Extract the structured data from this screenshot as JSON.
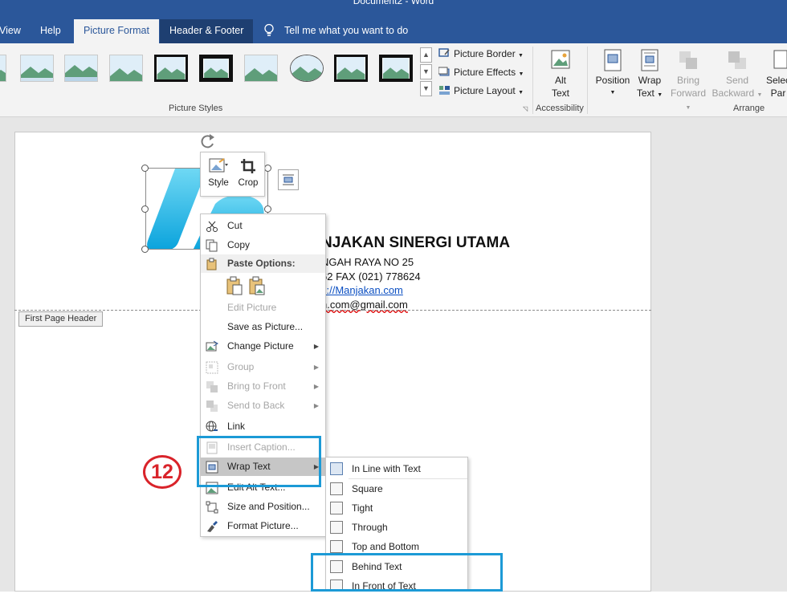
{
  "window": {
    "title": "Document2  -  Word"
  },
  "tabs": [
    {
      "label": "View",
      "state": "normal"
    },
    {
      "label": "Help",
      "state": "normal"
    },
    {
      "label": "Picture Format",
      "state": "active"
    },
    {
      "label": "Header & Footer",
      "state": "contextual"
    }
  ],
  "tell_me": "Tell me what you want to do",
  "ribbon": {
    "picture_border": "Picture Border",
    "picture_effects": "Picture Effects",
    "picture_layout": "Picture Layout",
    "group_picture_styles": "Picture Styles",
    "alt_text_line1": "Alt",
    "alt_text_line2": "Text",
    "group_accessibility": "Accessibility",
    "position_label": "Position",
    "wrap_line1": "Wrap",
    "wrap_line2": "Text",
    "bring_line1": "Bring",
    "bring_line2": "Forward",
    "send_line1": "Send",
    "send_line2": "Backward",
    "select_line1": "Selec",
    "select_line2": "Par",
    "group_arrange": "Arrange"
  },
  "document": {
    "company": "NJAKAN SINERGI UTAMA",
    "address": "NGAH RAYA NO 25",
    "phone": "62 FAX (021) 778624",
    "website": "s://Manjakan.com",
    "email": "n.com@gmail.com",
    "header_tag": "First Page Header"
  },
  "mini_toolbar": {
    "style": "Style",
    "crop": "Crop"
  },
  "context_menu": {
    "cut": "Cut",
    "copy": "Copy",
    "paste_options": "Paste Options:",
    "edit_picture": "Edit Picture",
    "save_as_picture": "Save as Picture...",
    "change_picture": "Change Picture",
    "group": "Group",
    "bring_to_front": "Bring to Front",
    "send_to_back": "Send to Back",
    "link": "Link",
    "insert_caption": "Insert Caption...",
    "wrap_text": "Wrap Text",
    "edit_alt_text": "Edit Alt Text...",
    "size_and_position": "Size and Position...",
    "format_picture": "Format Picture..."
  },
  "wrap_submenu": {
    "in_line": "In Line with Text",
    "square": "Square",
    "tight": "Tight",
    "through": "Through",
    "top_bottom": "Top and Bottom",
    "behind": "Behind Text",
    "in_front": "In Front of Text"
  },
  "annotation": {
    "step": "12"
  },
  "colors": {
    "ribbon_blue": "#2b579a",
    "highlight_box": "#1c9ad6",
    "step_badge": "#d9232a"
  }
}
